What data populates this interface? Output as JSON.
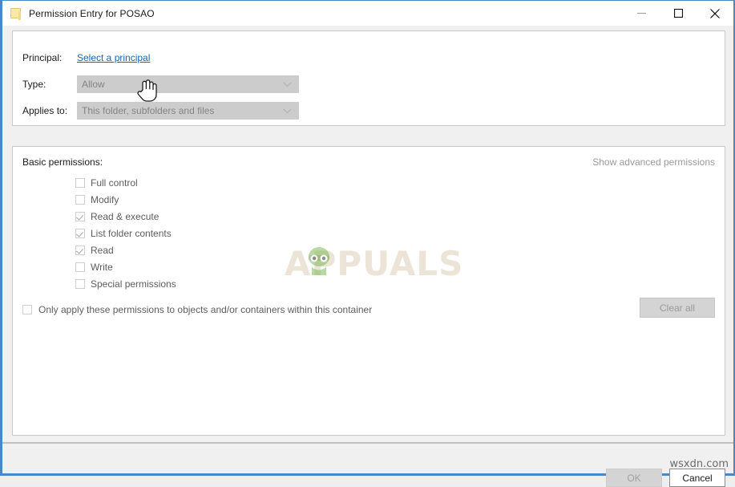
{
  "window": {
    "title": "Permission Entry for POSAO",
    "icon": "folder-icon",
    "accent_color": "#4a87c4",
    "controls": {
      "minimize": "Minimize",
      "maximize": "Maximize",
      "close": "Close"
    }
  },
  "form": {
    "principal": {
      "label": "Principal:",
      "link_text": "Select a principal",
      "link_color": "#1767b0"
    },
    "type": {
      "label": "Type:",
      "value": "Allow"
    },
    "applies_to": {
      "label": "Applies to:",
      "value": "This folder, subfolders and files"
    }
  },
  "permissions": {
    "heading": "Basic permissions:",
    "advanced_link": "Show advanced permissions",
    "items": [
      {
        "label": "Full control",
        "checked": false
      },
      {
        "label": "Modify",
        "checked": false
      },
      {
        "label": "Read & execute",
        "checked": true
      },
      {
        "label": "List folder contents",
        "checked": true
      },
      {
        "label": "Read",
        "checked": true
      },
      {
        "label": "Write",
        "checked": false
      },
      {
        "label": "Special permissions",
        "checked": false
      }
    ],
    "only_apply": {
      "label": "Only apply these permissions to objects and/or containers within this container",
      "checked": false
    },
    "clear_all_label": "Clear all"
  },
  "footer": {
    "ok_label": "OK",
    "cancel_label": "Cancel"
  },
  "watermarks": {
    "center": "APPUALS",
    "corner": "wsxdn.com"
  }
}
